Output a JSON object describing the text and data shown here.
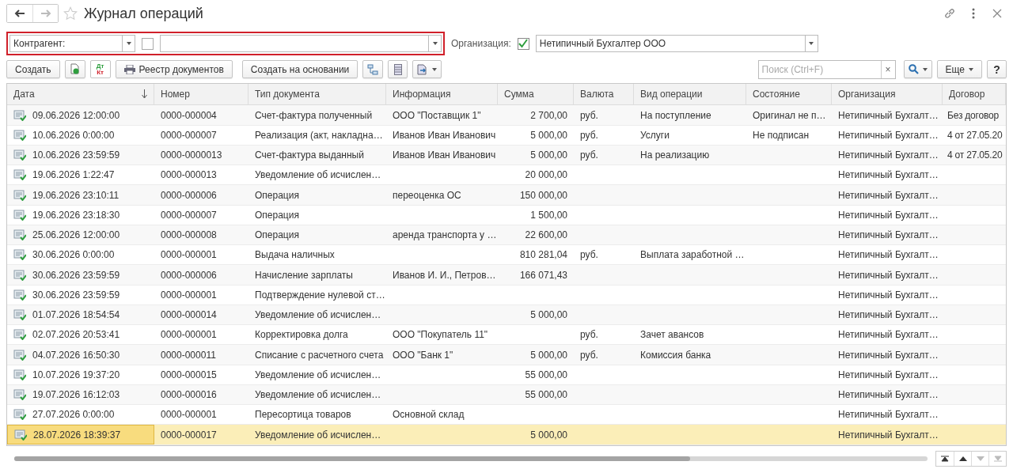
{
  "window": {
    "title": "Журнал операций",
    "back_enabled": true,
    "forward_enabled": false
  },
  "filters": {
    "counterparty": {
      "value": "Контрагент:",
      "checked": false
    },
    "organization": {
      "label": "Организация:",
      "checked": true,
      "value": "Нетипичный Бухгалтер ООО"
    }
  },
  "toolbar": {
    "create": "Создать",
    "debit": "Дт",
    "credit": "Кт",
    "registry": "Реестр документов",
    "create_based": "Создать на основании",
    "search": {
      "placeholder": "Поиск (Ctrl+F)"
    },
    "clear": "×",
    "more": "Еще",
    "help": "?"
  },
  "table": {
    "columns": [
      {
        "label": "Дата",
        "sorted": true
      },
      {
        "label": "Номер",
        "sorted": false
      },
      {
        "label": "Тип документа",
        "sorted": false
      },
      {
        "label": "Информация",
        "sorted": false
      },
      {
        "label": "Сумма",
        "sorted": false
      },
      {
        "label": "Валюта",
        "sorted": false
      },
      {
        "label": "Вид операции",
        "sorted": false
      },
      {
        "label": "Состояние",
        "sorted": false
      },
      {
        "label": "Организация",
        "sorted": false
      },
      {
        "label": "Договор",
        "sorted": false
      }
    ],
    "rows": [
      {
        "selected": false,
        "cells": [
          "09.06.2026 12:00:00",
          "0000-000004",
          "Счет-фактура полученный",
          "ООО \"Поставщик 1\"",
          "2 700,00",
          "руб.",
          "На поступление",
          "Оригинал не п…",
          "Нетипичный Бухгалт…",
          "Без договор"
        ]
      },
      {
        "selected": false,
        "cells": [
          "10.06.2026 0:00:00",
          "0000-000007",
          "Реализация (акт, накладна…",
          "Иванов Иван Иванович",
          "5 000,00",
          "руб.",
          "Услуги",
          "Не подписан",
          "Нетипичный Бухгалт…",
          "4 от 27.05.20"
        ]
      },
      {
        "selected": false,
        "cells": [
          "10.06.2026 23:59:59",
          "0000-0000013",
          "Счет-фактура выданный",
          "Иванов Иван Иванович",
          "5 000,00",
          "руб.",
          "На реализацию",
          null,
          "Нетипичный Бухгалт…",
          "4 от 27.05.20"
        ]
      },
      {
        "selected": false,
        "cells": [
          "19.06.2026 1:22:47",
          "0000-000013",
          "Уведомление об исчислен…",
          null,
          "20 000,00",
          null,
          null,
          null,
          "Нетипичный Бухгалт…",
          null
        ]
      },
      {
        "selected": false,
        "cells": [
          "19.06.2026 23:10:11",
          "0000-000006",
          "Операция",
          "переоценка ОС",
          "150 000,00",
          null,
          null,
          null,
          "Нетипичный Бухгалт…",
          null
        ]
      },
      {
        "selected": false,
        "cells": [
          "19.06.2026 23:18:30",
          "0000-000007",
          "Операция",
          null,
          "1 500,00",
          null,
          null,
          null,
          "Нетипичный Бухгалт…",
          null
        ]
      },
      {
        "selected": false,
        "cells": [
          "25.06.2026 12:00:00",
          "0000-000008",
          "Операция",
          "аренда транспорта у …",
          "22 600,00",
          null,
          null,
          null,
          "Нетипичный Бухгалт…",
          null
        ]
      },
      {
        "selected": false,
        "cells": [
          "30.06.2026 0:00:00",
          "0000-000001",
          "Выдача наличных",
          null,
          "810 281,04",
          "руб.",
          "Выплата заработной …",
          null,
          "Нетипичный Бухгалт…",
          null
        ]
      },
      {
        "selected": false,
        "cells": [
          "30.06.2026 23:59:59",
          "0000-000006",
          "Начисление зарплаты",
          "Иванов И. И., Петров…",
          "166 071,43",
          null,
          null,
          null,
          "Нетипичный Бухгалт…",
          null
        ]
      },
      {
        "selected": false,
        "cells": [
          "30.06.2026 23:59:59",
          "0000-000001",
          "Подтверждение нулевой ст…",
          null,
          null,
          null,
          null,
          null,
          "Нетипичный Бухгалт…",
          null
        ]
      },
      {
        "selected": false,
        "cells": [
          "01.07.2026 18:54:54",
          "0000-000014",
          "Уведомление об исчислен…",
          null,
          "5 000,00",
          null,
          null,
          null,
          "Нетипичный Бухгалт…",
          null
        ]
      },
      {
        "selected": false,
        "cells": [
          "02.07.2026 20:53:41",
          "0000-000001",
          "Корректировка долга",
          "ООО \"Покупатель 11\"",
          null,
          "руб.",
          "Зачет авансов",
          null,
          "Нетипичный Бухгалт…",
          null
        ]
      },
      {
        "selected": false,
        "cells": [
          "04.07.2026 16:50:30",
          "0000-000011",
          "Списание с расчетного счета",
          "ООО \"Банк 1\"",
          "5 000,00",
          "руб.",
          "Комиссия банка",
          null,
          "Нетипичный Бухгалт…",
          null
        ]
      },
      {
        "selected": false,
        "cells": [
          "10.07.2026 19:37:20",
          "0000-000015",
          "Уведомление об исчислен…",
          null,
          "55 000,00",
          null,
          null,
          null,
          "Нетипичный Бухгалт…",
          null
        ]
      },
      {
        "selected": false,
        "cells": [
          "19.07.2026 16:12:03",
          "0000-000016",
          "Уведомление об исчислен…",
          null,
          "55 000,00",
          null,
          null,
          null,
          "Нетипичный Бухгалт…",
          null
        ]
      },
      {
        "selected": false,
        "cells": [
          "27.07.2026 0:00:00",
          "0000-000001",
          "Пересортица товаров",
          "Основной склад",
          null,
          null,
          null,
          null,
          "Нетипичный Бухгалт…",
          null
        ]
      },
      {
        "selected": true,
        "cells": [
          "28.07.2026 18:39:37",
          "0000-000017",
          "Уведомление об исчислен…",
          null,
          "5 000,00",
          null,
          null,
          null,
          "Нетипичный Бухгалт…",
          null
        ]
      }
    ]
  },
  "pager": {
    "up_enabled": true,
    "down_enabled": false
  }
}
